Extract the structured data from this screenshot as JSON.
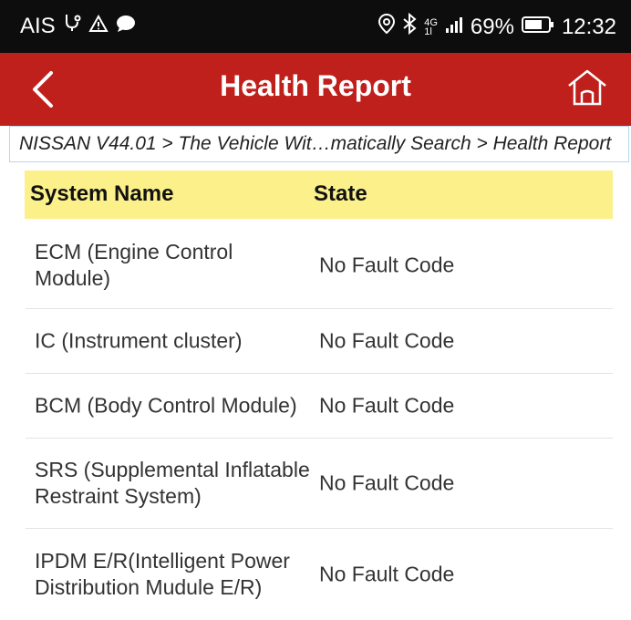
{
  "status_bar": {
    "carrier": "AIS",
    "network_type": "4G",
    "network_sub": "1l",
    "battery": "69%",
    "time": "12:32"
  },
  "app_bar": {
    "title": "Health Report"
  },
  "breadcrumb": "NISSAN V44.01 > The Vehicle Wit…matically Search > Health Report",
  "table": {
    "headers": {
      "name": "System Name",
      "state": "State"
    },
    "rows": [
      {
        "name": "ECM (Engine Control Module)",
        "state": "No Fault Code"
      },
      {
        "name": "IC (Instrument cluster)",
        "state": "No Fault Code"
      },
      {
        "name": "BCM (Body Control Module)",
        "state": "No Fault Code"
      },
      {
        "name": "SRS (Supplemental Inflatable Restraint System)",
        "state": "No Fault Code"
      },
      {
        "name": "IPDM E/R(Intelligent Power Distribution Mudule E/R)",
        "state": "No Fault Code"
      }
    ]
  },
  "colors": {
    "app_bar": "#c0201c",
    "header_highlight": "#fbf08a",
    "status_bar": "#0d0d0d"
  }
}
